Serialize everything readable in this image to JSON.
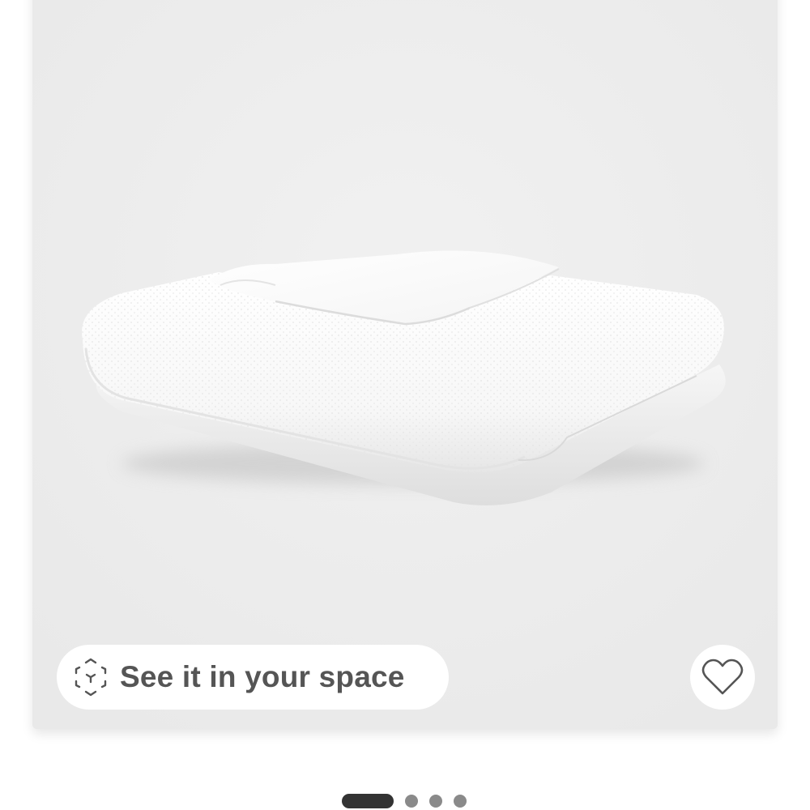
{
  "product": {
    "image_alt": "Folded white textured blanket",
    "ar_button": {
      "label": "See it in your space",
      "icon": "ar-cube-icon"
    },
    "favorite_button": {
      "icon": "heart-outline-icon",
      "saved": false
    }
  },
  "carousel": {
    "total": 4,
    "active_index": 0
  },
  "colors": {
    "card_background": "#eeeeee",
    "button_background": "#ffffff",
    "label_text": "#555555",
    "pager_active": "#333333",
    "pager_inactive": "#8a8a8a"
  }
}
